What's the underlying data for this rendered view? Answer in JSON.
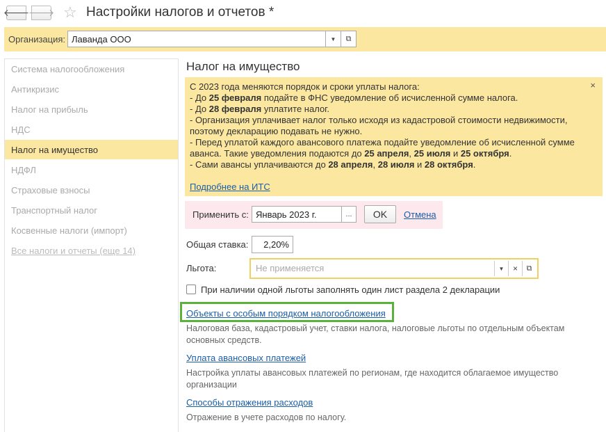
{
  "window": {
    "title": "Настройки налогов и отчетов *",
    "back_icon": "🡐",
    "forward_icon": "🡒",
    "star_icon": "☆"
  },
  "organization": {
    "label": "Организация:",
    "value": "Лаванда ООО"
  },
  "sidebar": {
    "items": [
      {
        "label": "Система налогообложения"
      },
      {
        "label": "Антикризис"
      },
      {
        "label": "Налог на прибыль"
      },
      {
        "label": "НДС"
      },
      {
        "label": "Налог на имущество"
      },
      {
        "label": "НДФЛ"
      },
      {
        "label": "Страховые взносы"
      },
      {
        "label": "Транспортный налог"
      },
      {
        "label": "Косвенные налоги (импорт)"
      },
      {
        "label": "Все налоги и отчеты (еще 14)"
      }
    ],
    "active_index": 4
  },
  "section": {
    "title": "Налог на имущество"
  },
  "notice": {
    "l1": "С 2023 года меняются порядок и сроки уплаты налога:",
    "l2a": " - До ",
    "l2b": "25 февраля",
    "l2c": " подайте в ФНС уведомление об исчисленной сумме налога.",
    "l3a": " - До ",
    "l3b": "28 февраля",
    "l3c": " уплатите налог.",
    "l4": " - Организация уплачивает налог только исходя из кадастровой стоимости недвижимости,",
    "l5": "поэтому декларацию подавать не нужно.",
    "l6": " - Перед уплатой каждого авансового платежа подайте уведомление об исчисленной сумме",
    "l7a": "аванса. Такие уведомления подаются до ",
    "l7b": "25 апреля",
    "l7c": ", ",
    "l7d": "25 июля",
    "l7e": " и ",
    "l7f": "25 октября",
    "l7g": ".",
    "l8a": " - Сами авансы уплачиваются до ",
    "l8b": "28 апреля",
    "l8c": ", ",
    "l8d": "28 июля",
    "l8e": " и ",
    "l8f": "28 октября",
    "l8g": ".",
    "link": "Подробнее на ИТС",
    "close": "×"
  },
  "apply": {
    "label": "Применить с:",
    "value": "Январь 2023 г.",
    "dots": "...",
    "ok": "OK",
    "cancel": "Отмена"
  },
  "rate": {
    "label": "Общая ставка:",
    "value": "2,20%"
  },
  "benefit": {
    "label": "Льгота:",
    "placeholder": "Не применяется"
  },
  "checkbox": {
    "label": "При наличии одной льготы заполнять один лист раздела 2 декларации",
    "checked": false
  },
  "links": [
    {
      "title": "Объекты с особым порядком налогообложения",
      "desc": "Налоговая база, кадастровый учет, ставки налога, налоговые льготы по отдельным объектам основных средств."
    },
    {
      "title": "Уплата авансовых платежей",
      "desc": "Настройка уплаты авансовых платежей по регионам, где находится облагаемое имущество организации"
    },
    {
      "title": "Способы отражения расходов",
      "desc": "Отражение в учете расходов по налогу."
    }
  ],
  "colors": {
    "accent_yellow": "#fbe7a0",
    "link_blue": "#1a5ea8",
    "highlight_green": "#59b33a",
    "apply_pink": "#fde8ee"
  }
}
